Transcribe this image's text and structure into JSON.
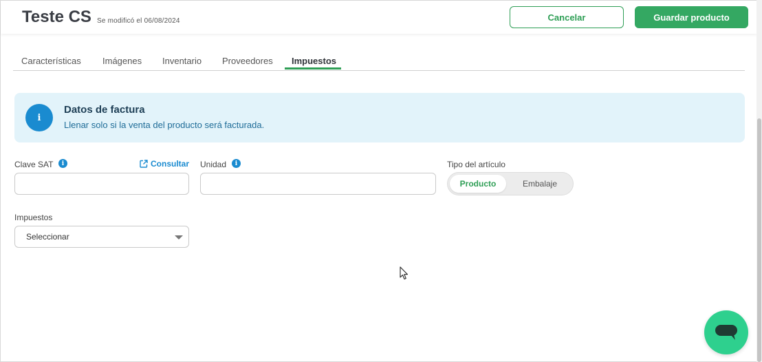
{
  "header": {
    "title": "Teste CS",
    "modified": "Se modificó el 06/08/2024",
    "cancel_label": "Cancelar",
    "save_label": "Guardar producto"
  },
  "tabs": [
    {
      "label": "Características",
      "active": false
    },
    {
      "label": "Imágenes",
      "active": false
    },
    {
      "label": "Inventario",
      "active": false
    },
    {
      "label": "Proveedores",
      "active": false
    },
    {
      "label": "Impuestos",
      "active": true
    }
  ],
  "banner": {
    "icon": "info-icon",
    "title": "Datos de factura",
    "text": "Llenar solo si la venta del producto será facturada."
  },
  "form": {
    "clave_sat": {
      "label": "Clave SAT",
      "value": "",
      "link_label": "Consultar"
    },
    "unidad": {
      "label": "Unidad",
      "value": ""
    },
    "tipo": {
      "label": "Tipo del artículo",
      "options": [
        "Producto",
        "Embalaje"
      ],
      "selected": "Producto"
    },
    "impuestos": {
      "label": "Impuestos",
      "selected": "Seleccionar"
    }
  },
  "colors": {
    "accent_green": "#2e9e55",
    "info_blue": "#1a8bd0",
    "banner_bg": "#e2f3fa",
    "chat_fab": "#2ed08e"
  }
}
